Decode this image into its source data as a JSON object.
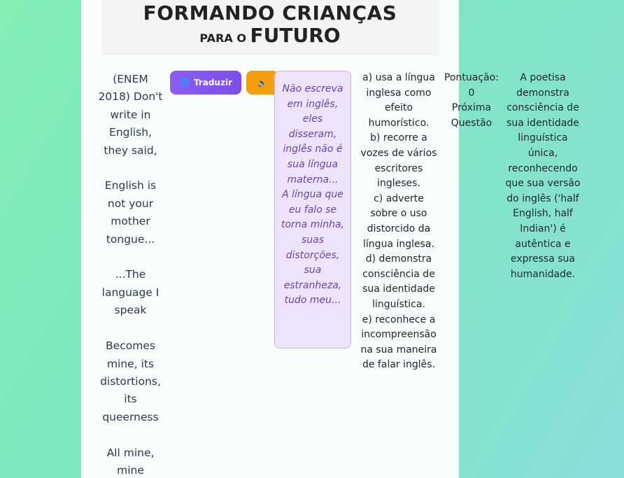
{
  "banner": {
    "line1": "FORMANDO CRIANÇAS",
    "line2_small": "PARA O ",
    "line2_big": "FUTURO"
  },
  "poem": {
    "text": "(ENEM 2018) Don't write in English, they said,\n\nEnglish is not your mother tongue...\n\n...The language I speak\n\nBecomes mine, its distortions, its queerness\n\nAll mine, mine"
  },
  "buttons": {
    "translate_label": "Traduzir",
    "translate_icon": "globe-icon",
    "audio_icon": "speaker-icon",
    "translate_color": "#8b5cf6",
    "audio_color": "#f59e0b"
  },
  "translation": {
    "text": "Não escreva em inglês, eles disseram, inglês não é sua língua materna...\nA língua que eu falo se torna minha, suas distorções, sua estranheza, tudo meu..."
  },
  "options": [
    "a) usa a língua inglesa como efeito humorístico.",
    "b) recorre a vozes de vários escritores ingleses.",
    "c) adverte sobre o uso distorcido da língua inglesa.",
    "d) demonstra consciência de sua identidade linguística.",
    "e) reconhece a incompreensão na sua maneira de falar inglês."
  ],
  "score": {
    "label": "Pontuação:",
    "value": "0",
    "next_label": "Próxima Questão"
  },
  "feedback": {
    "text": "A poetisa demonstra consciência de sua identidade linguística única, reconhecendo que sua versão do inglês ('half English, half Indian') é autêntica e expressa sua humanidade."
  }
}
